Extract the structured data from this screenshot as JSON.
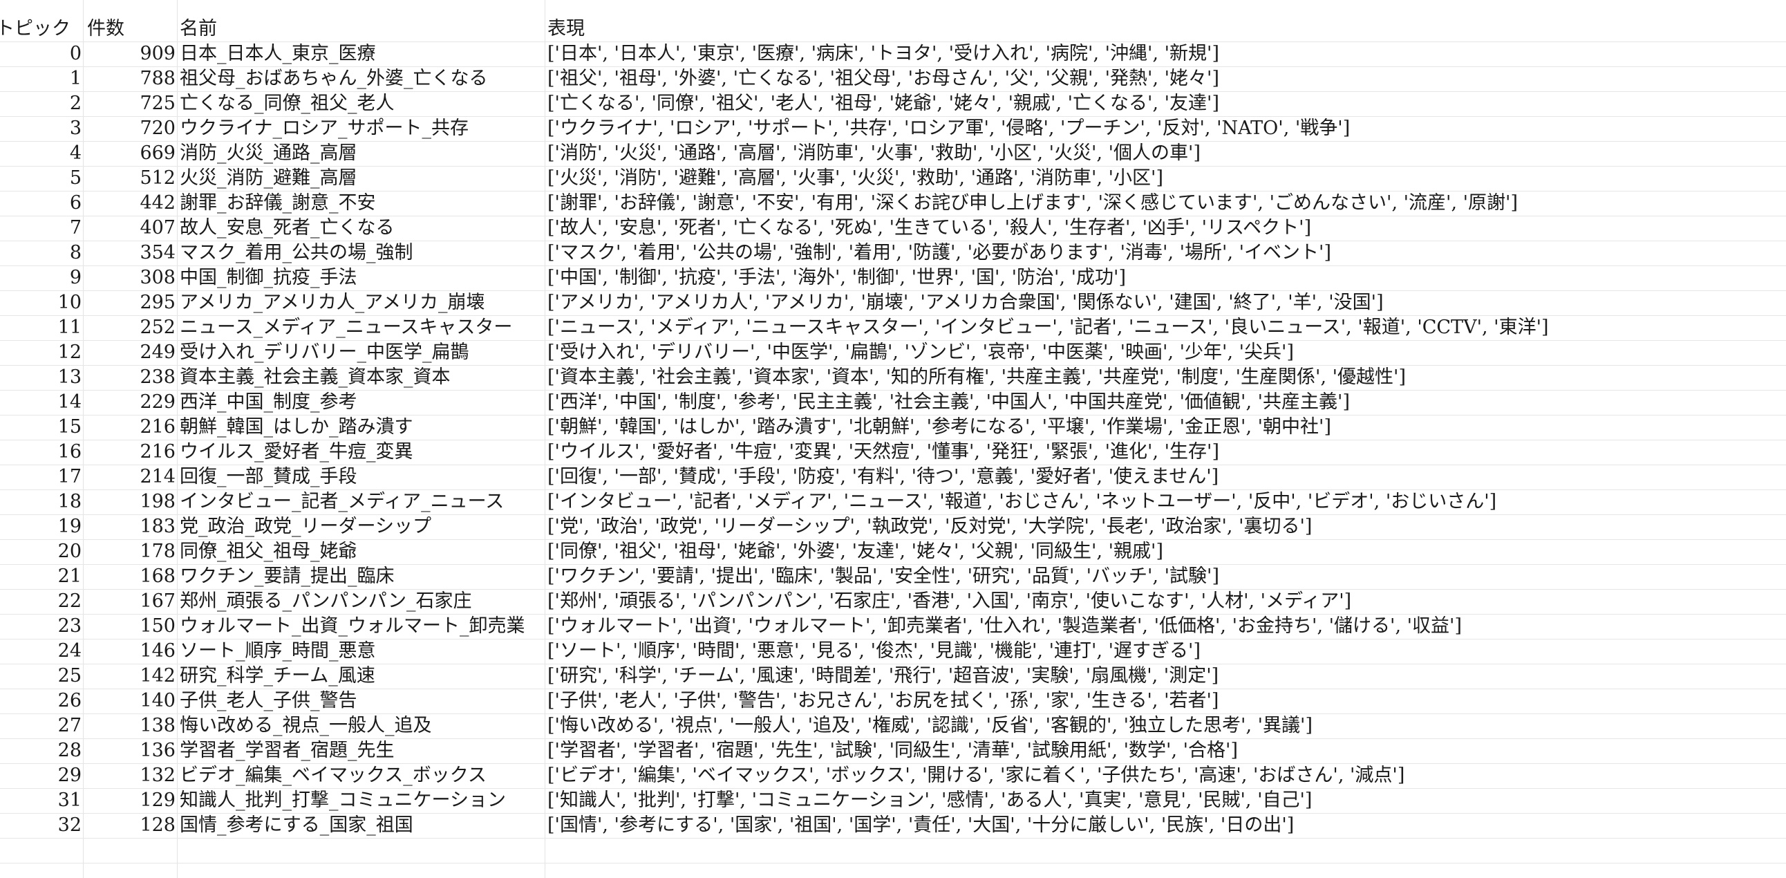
{
  "columns": {
    "topic": "トピック",
    "count": "件数",
    "name": "名前",
    "expression": "表現"
  },
  "rows": [
    {
      "topic": "0",
      "count": "909",
      "name": "日本_日本人_東京_医療",
      "expression": "['日本', '日本人', '東京', '医療', '病床', 'トヨタ', '受け入れ', '病院', '沖縄', '新規']"
    },
    {
      "topic": "1",
      "count": "788",
      "name": "祖父母_おばあちゃん_外婆_亡くなる",
      "expression": "['祖父', '祖母', '外婆', '亡くなる', '祖父母', 'お母さん', '父', '父親', '発熱', '姥々']"
    },
    {
      "topic": "2",
      "count": "725",
      "name": "亡くなる_同僚_祖父_老人",
      "expression": "['亡くなる', '同僚', '祖父', '老人', '祖母', '姥爺', '姥々', '親戚', '亡くなる', '友達']"
    },
    {
      "topic": "3",
      "count": "720",
      "name": "ウクライナ_ロシア_サポート_共存",
      "expression": "['ウクライナ', 'ロシア', 'サポート', '共存', 'ロシア軍', '侵略', 'プーチン', '反対', 'NATO', '戦争']"
    },
    {
      "topic": "4",
      "count": "669",
      "name": "消防_火災_通路_高層",
      "expression": "['消防', '火災', '通路', '高層', '消防車', '火事', '救助', '小区', '火災', '個人の車']"
    },
    {
      "topic": "5",
      "count": "512",
      "name": "火災_消防_避難_高層",
      "expression": "['火災', '消防', '避難', '高層', '火事', '火災', '救助', '通路', '消防車', '小区']"
    },
    {
      "topic": "6",
      "count": "442",
      "name": "謝罪_お辞儀_謝意_不安",
      "expression": "['謝罪', 'お辞儀', '謝意', '不安', '有用', '深くお詫び申し上げます', '深く感じています', 'ごめんなさい', '流産', '原謝']"
    },
    {
      "topic": "7",
      "count": "407",
      "name": "故人_安息_死者_亡くなる",
      "expression": "['故人', '安息', '死者', '亡くなる', '死ぬ', '生きている', '殺人', '生存者', '凶手', 'リスペクト']"
    },
    {
      "topic": "8",
      "count": "354",
      "name": "マスク_着用_公共の場_強制",
      "expression": "['マスク', '着用', '公共の場', '強制', '着用', '防護', '必要があります', '消毒', '場所', 'イベント']"
    },
    {
      "topic": "9",
      "count": "308",
      "name": "中国_制御_抗疫_手法",
      "expression": "['中国', '制御', '抗疫', '手法', '海外', '制御', '世界', '国', '防治', '成功']"
    },
    {
      "topic": "10",
      "count": "295",
      "name": "アメリカ_アメリカ人_アメリカ_崩壊",
      "expression": "['アメリカ', 'アメリカ人', 'アメリカ', '崩壊', 'アメリカ合衆国', '関係ない', '建国', '終了', '羊', '没国']"
    },
    {
      "topic": "11",
      "count": "252",
      "name": "ニュース_メディア_ニュースキャスター",
      "expression": "['ニュース', 'メディア', 'ニュースキャスター', 'インタビュー', '記者', 'ニュース', '良いニュース', '報道', 'CCTV', '東洋']"
    },
    {
      "topic": "12",
      "count": "249",
      "name": "受け入れ_デリバリー_中医学_扁鵲",
      "expression": "['受け入れ', 'デリバリー', '中医学', '扁鵲', 'ゾンビ', '哀帝', '中医薬', '映画', '少年', '尖兵']"
    },
    {
      "topic": "13",
      "count": "238",
      "name": "資本主義_社会主義_資本家_資本",
      "expression": "['資本主義', '社会主義', '資本家', '資本', '知的所有権', '共産主義', '共産党', '制度', '生産関係', '優越性']"
    },
    {
      "topic": "14",
      "count": "229",
      "name": "西洋_中国_制度_参考",
      "expression": "['西洋', '中国', '制度', '参考', '民主主義', '社会主義', '中国人', '中国共産党', '価値観', '共産主義']"
    },
    {
      "topic": "15",
      "count": "216",
      "name": "朝鮮_韓国_はしか_踏み潰す",
      "expression": "['朝鮮', '韓国', 'はしか', '踏み潰す', '北朝鮮', '参考になる', '平壌', '作業場', '金正恩', '朝中社']"
    },
    {
      "topic": "16",
      "count": "216",
      "name": "ウイルス_愛好者_牛痘_変異",
      "expression": "['ウイルス', '愛好者', '牛痘', '変異', '天然痘', '懂事', '発狂', '緊張', '進化', '生存']"
    },
    {
      "topic": "17",
      "count": "214",
      "name": "回復_一部_賛成_手段",
      "expression": "['回復', '一部', '賛成', '手段', '防疫', '有料', '待つ', '意義', '愛好者', '使えません']"
    },
    {
      "topic": "18",
      "count": "198",
      "name": "インタビュー_記者_メディア_ニュース",
      "expression": "['インタビュー', '記者', 'メディア', 'ニュース', '報道', 'おじさん', 'ネットユーザー', '反中', 'ビデオ', 'おじいさん']"
    },
    {
      "topic": "19",
      "count": "183",
      "name": "党_政治_政党_リーダーシップ",
      "expression": "['党', '政治', '政党', 'リーダーシップ', '執政党', '反対党', '大学院', '長老', '政治家', '裏切る']"
    },
    {
      "topic": "20",
      "count": "178",
      "name": "同僚_祖父_祖母_姥爺",
      "expression": "['同僚', '祖父', '祖母', '姥爺', '外婆', '友達', '姥々', '父親', '同級生', '親戚']"
    },
    {
      "topic": "21",
      "count": "168",
      "name": "ワクチン_要請_提出_臨床",
      "expression": "['ワクチン', '要請', '提出', '臨床', '製品', '安全性', '研究', '品質', 'バッチ', '試験']"
    },
    {
      "topic": "22",
      "count": "167",
      "name": "郑州_頑張る_パンパンパン_石家庄",
      "expression": "['郑州', '頑張る', 'パンパンパン', '石家庄', '香港', '入国', '南京', '使いこなす', '人材', 'メディア']"
    },
    {
      "topic": "23",
      "count": "150",
      "name": "ウォルマート_出資_ウォルマート_卸売業",
      "expression": "['ウォルマート', '出資', 'ウォルマート', '卸売業者', '仕入れ', '製造業者', '低価格', 'お金持ち', '儲ける', '収益']"
    },
    {
      "topic": "24",
      "count": "146",
      "name": "ソート_順序_時間_悪意",
      "expression": "['ソート', '順序', '時間', '悪意', '見る', '俊杰', '見識', '機能', '連打', '遅すぎる']"
    },
    {
      "topic": "25",
      "count": "142",
      "name": "研究_科学_チーム_風速",
      "expression": "['研究', '科学', 'チーム', '風速', '時間差', '飛行', '超音波', '実験', '扇風機', '測定']"
    },
    {
      "topic": "26",
      "count": "140",
      "name": "子供_老人_子供_警告",
      "expression": "['子供', '老人', '子供', '警告', 'お兄さん', 'お尻を拭く', '孫', '家', '生きる', '若者']"
    },
    {
      "topic": "27",
      "count": "138",
      "name": "悔い改める_視点_一般人_追及",
      "expression": "['悔い改める', '視点', '一般人', '追及', '権威', '認識', '反省', '客観的', '独立した思考', '異議']"
    },
    {
      "topic": "28",
      "count": "136",
      "name": "学習者_学習者_宿題_先生",
      "expression": "['学習者', '学習者', '宿題', '先生', '試験', '同級生', '清華', '試験用紙', '数学', '合格']"
    },
    {
      "topic": "29",
      "count": "132",
      "name": "ビデオ_編集_ベイマックス_ボックス",
      "expression": "['ビデオ', '編集', 'ベイマックス', 'ボックス', '開ける', '家に着く', '子供たち', '高速', 'おばさん', '減点']"
    },
    {
      "topic": "31",
      "count": "129",
      "name": "知識人_批判_打撃_コミュニケーション",
      "expression": "['知識人', '批判', '打撃', 'コミュニケーション', '感情', 'ある人', '真実', '意見', '民賊', '自己']"
    },
    {
      "topic": "32",
      "count": "128",
      "name": "国情_参考にする_国家_祖国",
      "expression": "['国情', '参考にする', '国家', '祖国', '国学', '責任', '大国', '十分に厳しい', '民族', '日の出']"
    }
  ]
}
